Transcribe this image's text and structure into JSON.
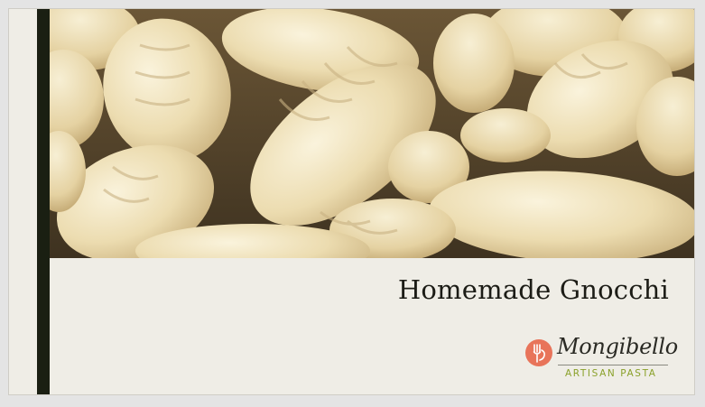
{
  "slide": {
    "title": "Homemade Gnocchi",
    "photo_subject": "gnocchi-photo",
    "accent_color": "#1a1f12",
    "background_color": "#efede6"
  },
  "logo": {
    "brand_name": "Mongibello",
    "tagline": "ARTISAN PASTA",
    "mark_icon": "pasta-fork-icon",
    "mark_color": "#e8745a",
    "tagline_color": "#8aa12a"
  }
}
